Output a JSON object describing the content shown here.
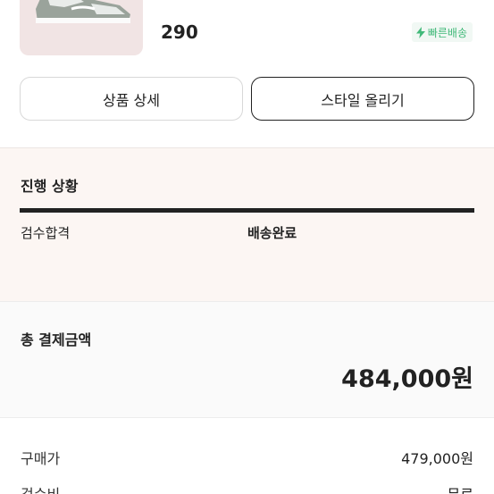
{
  "product": {
    "size": "290",
    "badge_label": "빠른배송",
    "badge_color": "#41b979",
    "image_icon": "sneaker-image"
  },
  "actions": {
    "detail_label": "상품 상세",
    "style_label": "스타일 올리기"
  },
  "progress": {
    "title": "진행 상황",
    "steps": [
      "검수합격",
      "배송완료"
    ],
    "progress_fraction": 1.0
  },
  "payment": {
    "total_label": "총 결제금액",
    "total_amount": "484,000원",
    "rows": [
      {
        "label": "구매가",
        "value": "479,000원"
      },
      {
        "label": "검수비",
        "value": "무료"
      }
    ]
  }
}
